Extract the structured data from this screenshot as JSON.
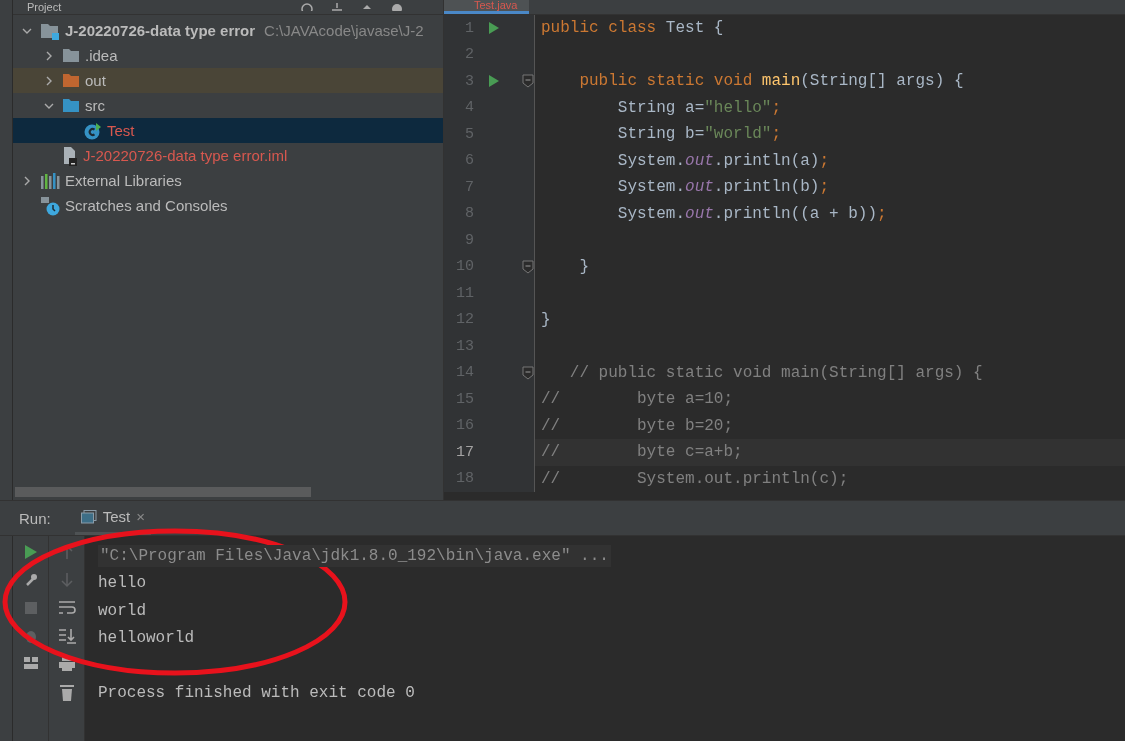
{
  "project_panel": {
    "title": "Project",
    "tree": [
      {
        "label": "J-20220726-data type error",
        "detail": "C:\\JAVAcode\\javase\\J-2",
        "kind": "module",
        "expanded": true,
        "selected": false,
        "error": false,
        "excluded": false,
        "children": [
          {
            "label": ".idea",
            "kind": "folder",
            "expanded": false,
            "selected": false,
            "error": false,
            "excluded": false
          },
          {
            "label": "out",
            "kind": "excluded-folder",
            "expanded": false,
            "selected": false,
            "error": false,
            "excluded": true
          },
          {
            "label": "src",
            "kind": "source-folder",
            "expanded": true,
            "selected": false,
            "error": false,
            "excluded": false,
            "children": [
              {
                "label": "Test",
                "kind": "class",
                "selected": true,
                "error": true,
                "excluded": false
              }
            ]
          },
          {
            "label": "J-20220726-data type error.iml",
            "kind": "file",
            "selected": false,
            "error": true,
            "excluded": false
          }
        ]
      },
      {
        "label": "External Libraries",
        "kind": "libraries",
        "expanded": false,
        "selected": false,
        "error": false,
        "excluded": false
      },
      {
        "label": "Scratches and Consoles",
        "kind": "scratches",
        "selected": false,
        "error": false,
        "excluded": false
      }
    ]
  },
  "editor": {
    "tab": {
      "label": "Test.java",
      "selected": true
    },
    "lines": [
      {
        "number": "1",
        "run": true,
        "fold": false,
        "current": false,
        "segments": [
          {
            "kind": "keyword",
            "text": "public class "
          },
          {
            "kind": "plain",
            "text": "Test {"
          }
        ]
      },
      {
        "number": "2",
        "run": false,
        "fold": false,
        "current": false
      },
      {
        "number": "3",
        "run": true,
        "fold": true,
        "current": false,
        "segments": [
          {
            "kind": "keyword",
            "text": "    public static void "
          },
          {
            "kind": "method",
            "text": "main"
          },
          {
            "kind": "plain",
            "text": "(String[] args) {"
          }
        ]
      },
      {
        "number": "4",
        "run": false,
        "fold": false,
        "current": false,
        "segments": [
          {
            "kind": "plain",
            "text": "        String a="
          },
          {
            "kind": "string",
            "text": "\"hello\""
          },
          {
            "kind": "keyword",
            "text": ";"
          }
        ]
      },
      {
        "number": "5",
        "run": false,
        "fold": false,
        "current": false,
        "segments": [
          {
            "kind": "plain",
            "text": "        String b="
          },
          {
            "kind": "string",
            "text": "\"world\""
          },
          {
            "kind": "keyword",
            "text": ";"
          }
        ]
      },
      {
        "number": "6",
        "run": false,
        "fold": false,
        "current": false,
        "segments": [
          {
            "kind": "plain",
            "text": "        System."
          },
          {
            "kind": "field",
            "text": "out"
          },
          {
            "kind": "plain",
            "text": ".println(a)"
          },
          {
            "kind": "keyword",
            "text": ";"
          }
        ]
      },
      {
        "number": "7",
        "run": false,
        "fold": false,
        "current": false,
        "segments": [
          {
            "kind": "plain",
            "text": "        System."
          },
          {
            "kind": "field",
            "text": "out"
          },
          {
            "kind": "plain",
            "text": ".println(b)"
          },
          {
            "kind": "keyword",
            "text": ";"
          }
        ]
      },
      {
        "number": "8",
        "run": false,
        "fold": false,
        "current": false,
        "segments": [
          {
            "kind": "plain",
            "text": "        System."
          },
          {
            "kind": "field",
            "text": "out"
          },
          {
            "kind": "plain",
            "text": ".println((a + b))"
          },
          {
            "kind": "keyword",
            "text": ";"
          }
        ]
      },
      {
        "number": "9",
        "run": false,
        "fold": false,
        "current": false
      },
      {
        "number": "10",
        "run": false,
        "fold": true,
        "current": false,
        "segments": [
          {
            "kind": "plain",
            "text": "    }"
          }
        ]
      },
      {
        "number": "11",
        "run": false,
        "fold": false,
        "current": false
      },
      {
        "number": "12",
        "run": false,
        "fold": false,
        "current": false,
        "segments": [
          {
            "kind": "plain",
            "text": "}"
          }
        ]
      },
      {
        "number": "13",
        "run": false,
        "fold": false,
        "current": false
      },
      {
        "number": "14",
        "run": false,
        "fold": true,
        "current": false,
        "segments": [
          {
            "kind": "comment",
            "text": "   // public static void main(String[] args) {"
          }
        ]
      },
      {
        "number": "15",
        "run": false,
        "fold": false,
        "current": false,
        "segments": [
          {
            "kind": "comment",
            "text": "//        byte a=10;"
          }
        ]
      },
      {
        "number": "16",
        "run": false,
        "fold": false,
        "current": false,
        "segments": [
          {
            "kind": "comment",
            "text": "//        byte b=20;"
          }
        ]
      },
      {
        "number": "17",
        "run": false,
        "fold": false,
        "current": true,
        "segments": [
          {
            "kind": "comment",
            "text": "//        byte c=a+b;"
          }
        ]
      },
      {
        "number": "18",
        "run": false,
        "fold": false,
        "current": false,
        "segments": [
          {
            "kind": "comment",
            "text": "//        System.out.println(c);"
          }
        ]
      }
    ]
  },
  "run_panel": {
    "label": "Run:",
    "tab": {
      "label": "Test",
      "selected": true,
      "close": "×"
    },
    "console": [
      {
        "kind": "command",
        "text": "\"C:\\Program Files\\Java\\jdk1.8.0_192\\bin\\java.exe\" ..."
      },
      {
        "kind": "output",
        "text": "hello"
      },
      {
        "kind": "output",
        "text": "world"
      },
      {
        "kind": "output",
        "text": "helloworld"
      },
      {
        "kind": "blank"
      },
      {
        "kind": "exit",
        "text": "Process finished with exit code 0"
      }
    ]
  }
}
